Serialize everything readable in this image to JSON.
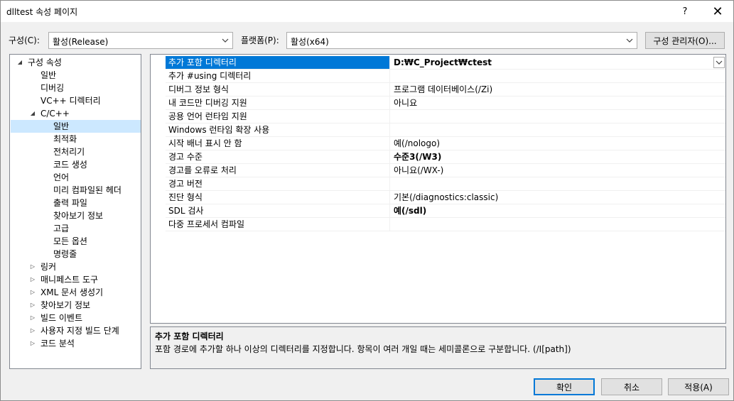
{
  "window": {
    "title": "dlltest 속성 페이지",
    "help_glyph": "?",
    "close_glyph": "✕"
  },
  "config": {
    "config_label": "구성(C):",
    "config_value": "활성(Release)",
    "platform_label": "플랫폼(P):",
    "platform_value": "활성(x64)",
    "manager_label": "구성 관리자(O)..."
  },
  "tree": {
    "items": [
      {
        "label": "구성 속성",
        "state": "expanded"
      },
      {
        "label": "일반"
      },
      {
        "label": "디버깅"
      },
      {
        "label": "VC++ 디렉터리"
      },
      {
        "label": "C/C++",
        "state": "expanded"
      },
      {
        "label": "일반",
        "selected": true
      },
      {
        "label": "최적화"
      },
      {
        "label": "전처리기"
      },
      {
        "label": "코드 생성"
      },
      {
        "label": "언어"
      },
      {
        "label": "미리 컴파일된 헤더"
      },
      {
        "label": "출력 파일"
      },
      {
        "label": "찾아보기 정보"
      },
      {
        "label": "고급"
      },
      {
        "label": "모든 옵션"
      },
      {
        "label": "명령줄"
      },
      {
        "label": "링커",
        "state": "collapsed"
      },
      {
        "label": "매니페스트 도구",
        "state": "collapsed"
      },
      {
        "label": "XML 문서 생성기",
        "state": "collapsed"
      },
      {
        "label": "찾아보기 정보",
        "state": "collapsed"
      },
      {
        "label": "빌드 이벤트",
        "state": "collapsed"
      },
      {
        "label": "사용자 지정 빌드 단계",
        "state": "collapsed"
      },
      {
        "label": "코드 분석",
        "state": "collapsed"
      }
    ]
  },
  "grid": {
    "rows": [
      {
        "name": "추가 포함 디렉터리",
        "value": "D:₩C_Project₩ctest",
        "selected": true
      },
      {
        "name": "추가 #using 디렉터리",
        "value": ""
      },
      {
        "name": "디버그 정보 형식",
        "value": "프로그램 데이터베이스(/Zi)"
      },
      {
        "name": "내 코드만 디버깅 지원",
        "value": "아니요"
      },
      {
        "name": "공용 언어 런타임 지원",
        "value": ""
      },
      {
        "name": "Windows 런타임 확장 사용",
        "value": ""
      },
      {
        "name": "시작 배너 표시 안 함",
        "value": "예(/nologo)"
      },
      {
        "name": "경고 수준",
        "value": "수준3(/W3)",
        "bold": true
      },
      {
        "name": "경고를 오류로 처리",
        "value": "아니요(/WX-)"
      },
      {
        "name": "경고 버전",
        "value": ""
      },
      {
        "name": "진단 형식",
        "value": "기본(/diagnostics:classic)"
      },
      {
        "name": "SDL 검사",
        "value": "예(/sdl)",
        "bold": true
      },
      {
        "name": "다중 프로세서 컴파일",
        "value": ""
      }
    ]
  },
  "description": {
    "title": "추가 포함 디렉터리",
    "text": "포함 경로에 추가할 하나 이상의 디렉터리를 지정합니다. 항목이 여러 개일 때는 세미콜론으로 구분합니다.      (/I[path])"
  },
  "buttons": {
    "ok": "확인",
    "cancel": "취소",
    "apply": "적용(A)"
  },
  "colors": {
    "selection": "#0078d7",
    "tree_selection": "#cce8ff",
    "window_bg": "#f0f0f0"
  }
}
